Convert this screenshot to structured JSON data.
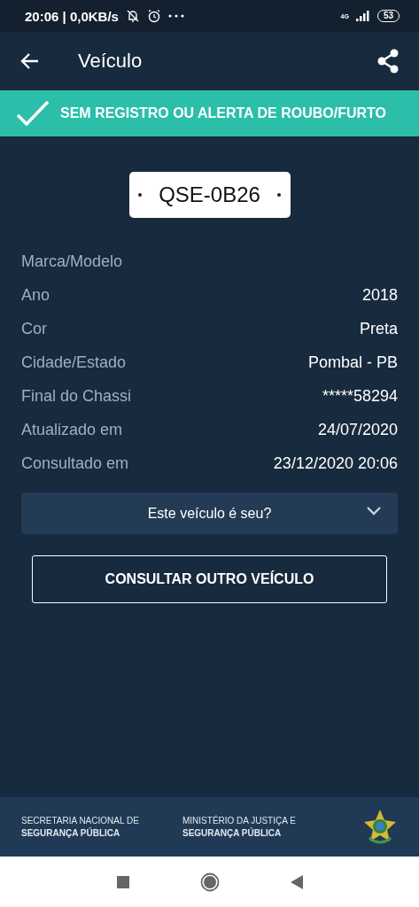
{
  "status_bar": {
    "time": "20:06 | 0,0KB/s",
    "network": "4G",
    "battery": "53"
  },
  "app_bar": {
    "title": "Veículo"
  },
  "banner": {
    "text": "SEM REGISTRO OU ALERTA DE ROUBO/FURTO"
  },
  "plate": "QSE-0B26",
  "details": [
    {
      "label": "Marca/Modelo"
    },
    {
      "label": "Ano",
      "value": "2018"
    },
    {
      "label": "Cor",
      "value": "Preta"
    },
    {
      "label": "Cidade/Estado",
      "value": "Pombal - PB"
    },
    {
      "label": "Final do Chassi",
      "value": "*****58294"
    },
    {
      "label": "Atualizado em",
      "value": "24/07/2020"
    },
    {
      "label": "Consultado em",
      "value": "23/12/2020 20:06"
    }
  ],
  "ownership": {
    "label": "Este veículo é seu?",
    "expanded": false
  },
  "button": "CONSULTAR OUTRO VEÍCULO",
  "footer": [
    {
      "line1": "SECRETARIA NACIONAL DE",
      "line2": "SEGURANÇA PÚBLICA"
    },
    {
      "line1": "MINISTÉRIO DA JUSTIÇA E",
      "line2": "SEGURANÇA PÚBLICA"
    }
  ]
}
